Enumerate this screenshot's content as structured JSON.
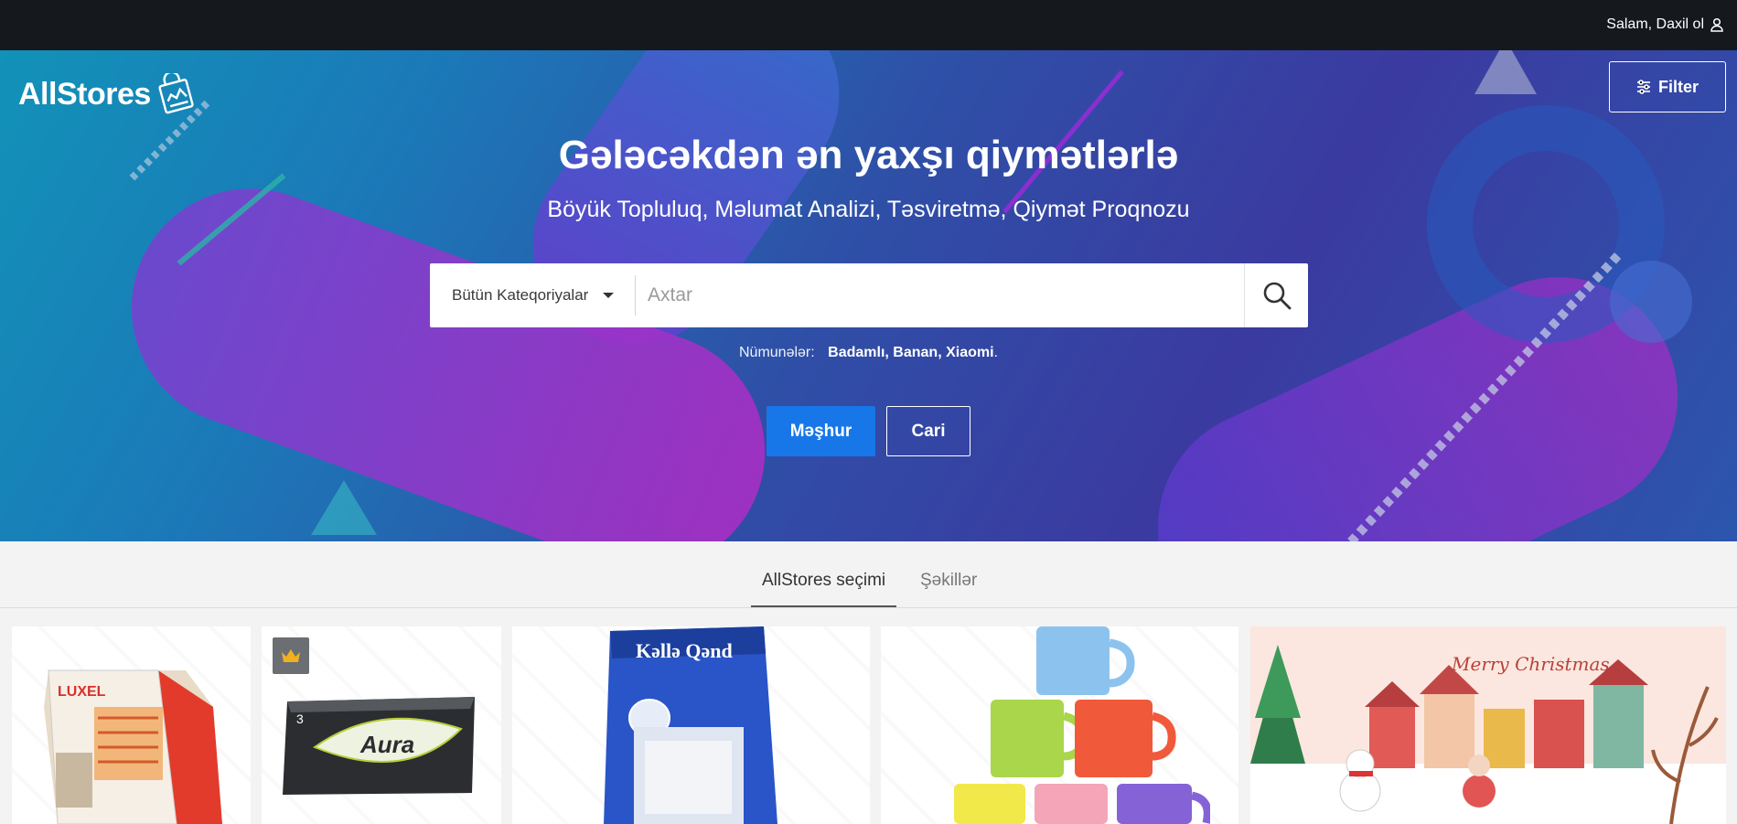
{
  "topbar": {
    "greeting": "Salam, Daxil ol",
    "user_icon": "user-icon"
  },
  "brand": {
    "name": "AllStores",
    "icon": "store-bag-icon"
  },
  "filter": {
    "label": "Filter",
    "icon": "sliders-icon"
  },
  "hero": {
    "title": "Gələcəkdən ən yaxşı qiymətlərlə",
    "subtitle": "Böyük Topluluq, Məlumat Analizi, Təsviretmə, Qiymət Proqnozu"
  },
  "search": {
    "category_label": "Bütün Kateqoriyalar",
    "placeholder": "Axtar",
    "value": "",
    "icon": "search-icon"
  },
  "examples": {
    "label": "Nümunələr:",
    "items": "Badamlı, Banan, Xiaomi",
    "trailing": "."
  },
  "buttons": {
    "popular": "Məşhur",
    "current": "Cari"
  },
  "tabs": {
    "active": "AllStores seçimi",
    "inactive": "Şəkillər"
  },
  "colors": {
    "topbar": "#15191d",
    "primary_button": "#1877e8",
    "hero_start": "#1292b8",
    "hero_end": "#3b3aa0"
  },
  "products": [
    {
      "brand_text": "LUXEL",
      "badge": ""
    },
    {
      "brand_text": "Aura",
      "badge": "crown-icon"
    },
    {
      "brand_text": "Kəllə Qənd",
      "badge": ""
    },
    {
      "brand_text": "",
      "badge": ""
    },
    {
      "brand_text": "Merry Christmas",
      "badge": ""
    }
  ]
}
